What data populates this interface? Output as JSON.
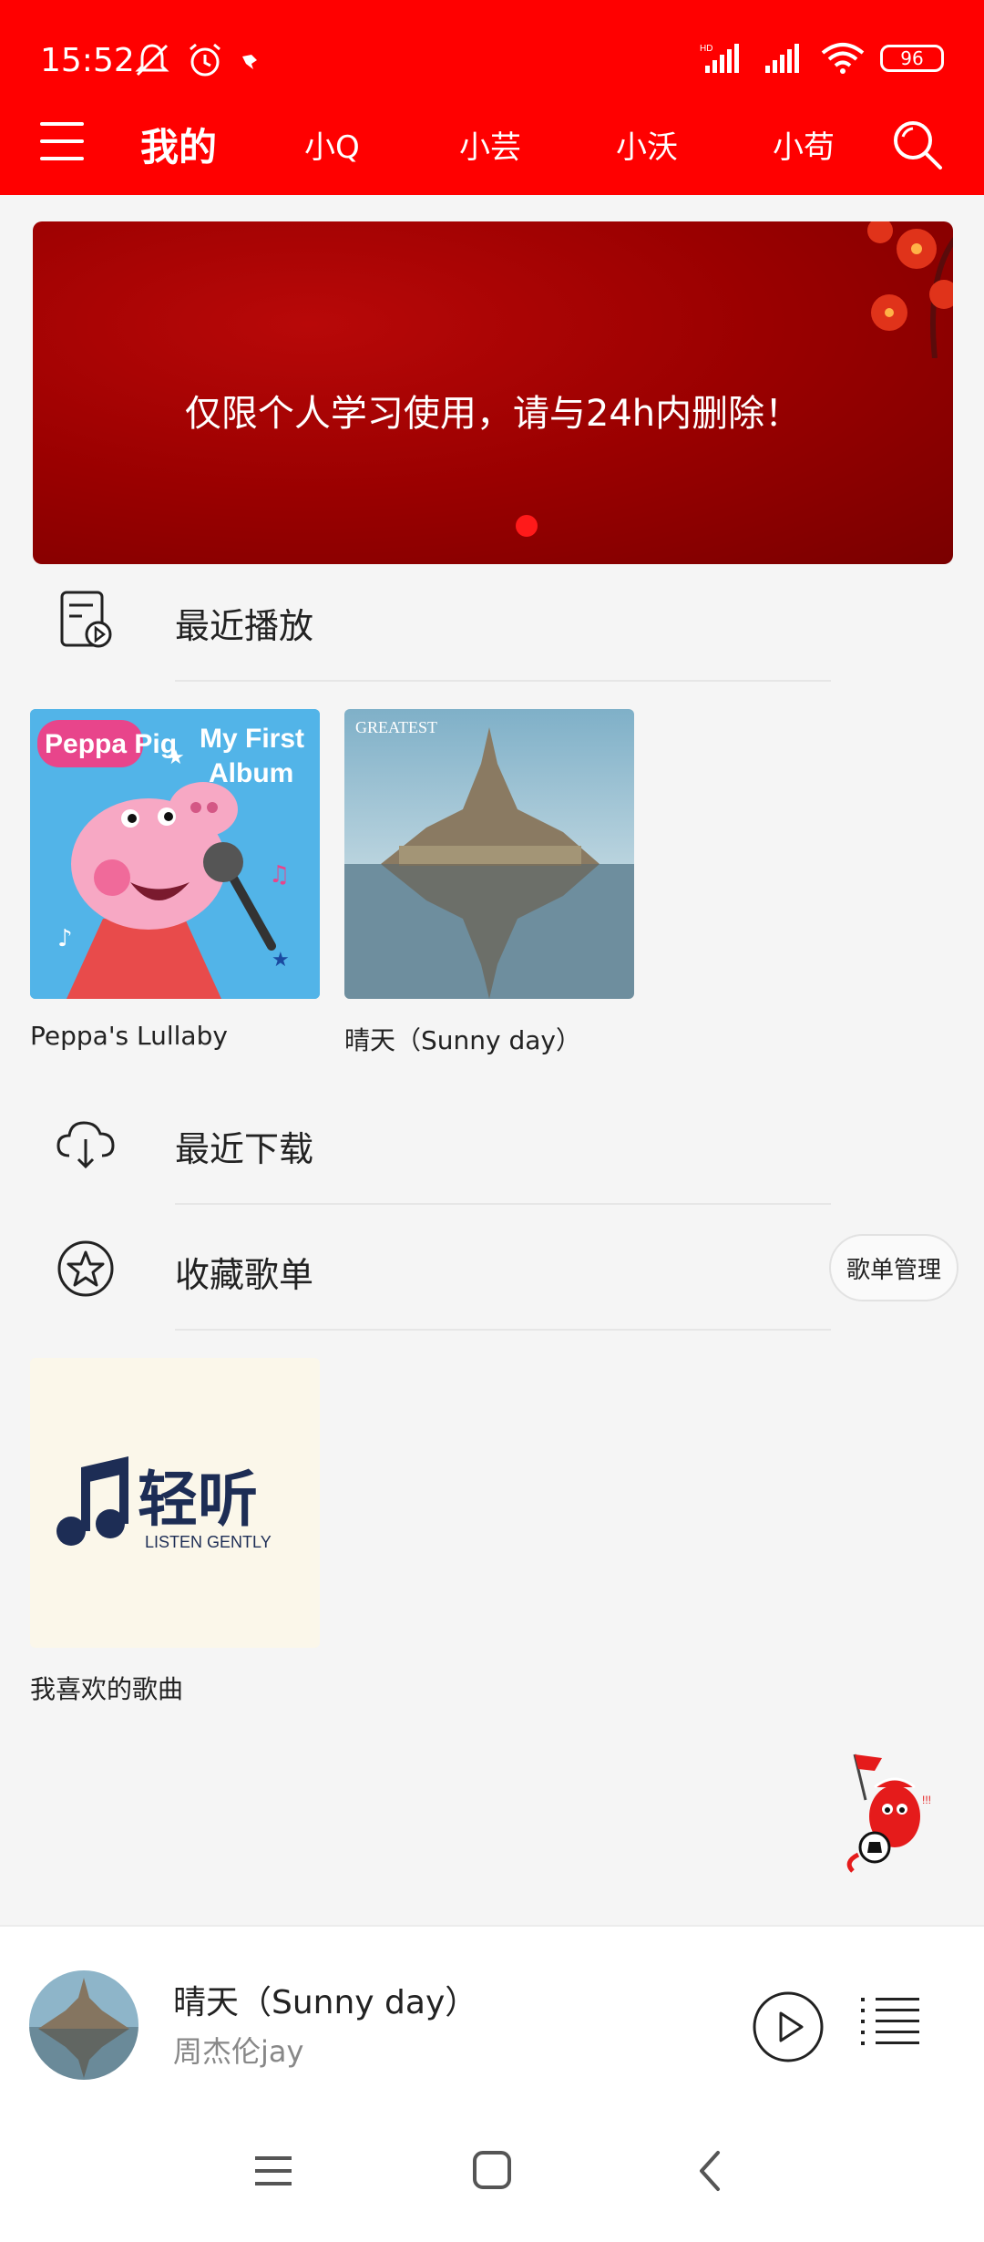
{
  "status_bar": {
    "time": "15:52",
    "battery": "96",
    "icons": [
      "mute-icon",
      "alarm-icon",
      "app-notification-icon",
      "hd-signal-icon",
      "signal-icon",
      "wifi-icon",
      "battery-icon"
    ]
  },
  "header": {
    "tabs": [
      {
        "label": "我的",
        "active": true
      },
      {
        "label": "小Q",
        "active": false
      },
      {
        "label": "小芸",
        "active": false
      },
      {
        "label": "小沃",
        "active": false
      },
      {
        "label": "小苟",
        "active": false
      }
    ]
  },
  "banner": {
    "text": "仅限个人学习使用，请与24h内删除！"
  },
  "sections": {
    "recent_play": "最近播放",
    "recent_download": "最近下载",
    "favorite_playlists": "收藏歌单",
    "playlist_manage": "歌单管理"
  },
  "recent_albums": [
    {
      "caption": "Peppa's Lullaby",
      "cover_lines": [
        "Peppa Pig",
        "My First",
        "Album"
      ]
    },
    {
      "caption": "晴天（Sunny day）",
      "cover_lines": [
        "GREATEST"
      ]
    }
  ],
  "favorite_list": [
    {
      "caption": "我喜欢的歌曲",
      "logo_text": "轻听",
      "logo_sub": "LISTEN GENTLY"
    }
  ],
  "player": {
    "title": "晴天（Sunny day）",
    "artist": "周杰伦jay"
  },
  "colors": {
    "brand": "#ff0000",
    "banner": "#9a0000"
  }
}
